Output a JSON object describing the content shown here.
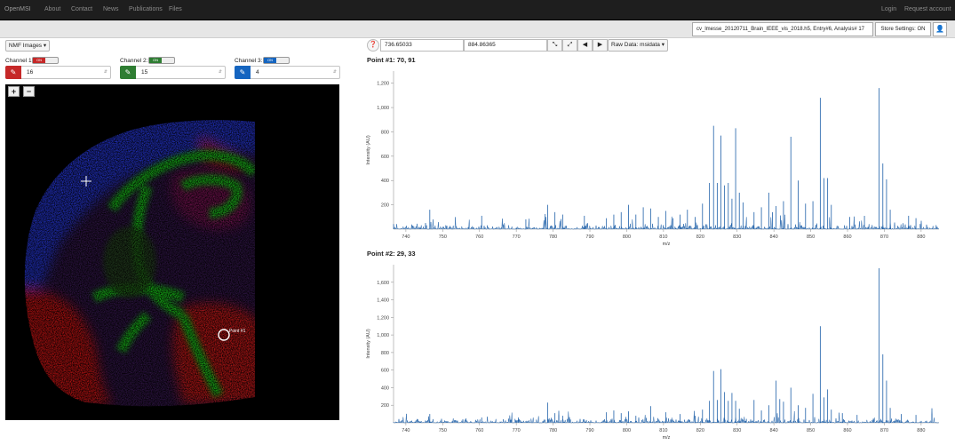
{
  "navbar": {
    "brand": "OpenMSI",
    "items": [
      "About",
      "Contact",
      "News",
      "Publications",
      "Files"
    ],
    "right": [
      "Login",
      "Request account"
    ]
  },
  "toolbar": {
    "file_name": "cv_lmesse_20120711_Brain_IEEE_vis_2018.h5, Entry#6, Analysis# 17",
    "store_settings": "Store Settings: ON",
    "user_icon": "user-icon"
  },
  "image_panel": {
    "dropdown_label": "NMF Images ▾",
    "channels": [
      {
        "label": "Channel 1:",
        "toggle": "ON",
        "value": "16",
        "color": "#c62828"
      },
      {
        "label": "Channel 2:",
        "toggle": "ON",
        "value": "15",
        "color": "#2e7d32"
      },
      {
        "label": "Channel 3:",
        "toggle": "ON",
        "value": "4",
        "color": "#1565c0"
      }
    ],
    "zoom_in": "+",
    "zoom_out": "−",
    "marker_label": "Point #1"
  },
  "spectrum_panel": {
    "mz_min": "736.65033",
    "mz_max": "884.86365",
    "raw_data_label": "Raw Data: msidata ▾",
    "point1_title": "Point #1: 70, 91",
    "point2_title": "Point #2: 29, 33"
  },
  "chart_data": [
    {
      "type": "line",
      "title": "Point #1: 70, 91",
      "xlabel": "m/z",
      "ylabel": "Intensity (AU)",
      "xlim": [
        736.65,
        884.86
      ],
      "ylim": [
        0,
        1300
      ],
      "xticks": [
        "740",
        "750",
        "760",
        "770",
        "780",
        "790",
        "800",
        "810",
        "820",
        "830",
        "840",
        "850",
        "860",
        "870",
        "880"
      ],
      "yticks": [
        "200",
        "400",
        "600",
        "800",
        "1,000",
        "1,200"
      ],
      "peaks": [
        {
          "x": 746.5,
          "y": 160
        },
        {
          "x": 760.6,
          "y": 110
        },
        {
          "x": 772.6,
          "y": 80
        },
        {
          "x": 778.5,
          "y": 200
        },
        {
          "x": 780.5,
          "y": 140
        },
        {
          "x": 782.6,
          "y": 120
        },
        {
          "x": 788.5,
          "y": 110
        },
        {
          "x": 794.5,
          "y": 90
        },
        {
          "x": 796.5,
          "y": 120
        },
        {
          "x": 798.5,
          "y": 140
        },
        {
          "x": 800.5,
          "y": 200
        },
        {
          "x": 802.5,
          "y": 120
        },
        {
          "x": 804.5,
          "y": 180
        },
        {
          "x": 806.5,
          "y": 170
        },
        {
          "x": 808.6,
          "y": 100
        },
        {
          "x": 810.6,
          "y": 150
        },
        {
          "x": 812.6,
          "y": 90
        },
        {
          "x": 814.5,
          "y": 120
        },
        {
          "x": 816.5,
          "y": 160
        },
        {
          "x": 818.6,
          "y": 100
        },
        {
          "x": 820.6,
          "y": 210
        },
        {
          "x": 822.5,
          "y": 380
        },
        {
          "x": 823.6,
          "y": 850
        },
        {
          "x": 824.6,
          "y": 380
        },
        {
          "x": 825.6,
          "y": 770
        },
        {
          "x": 826.6,
          "y": 360
        },
        {
          "x": 827.6,
          "y": 380
        },
        {
          "x": 828.6,
          "y": 250
        },
        {
          "x": 829.6,
          "y": 830
        },
        {
          "x": 830.6,
          "y": 300
        },
        {
          "x": 831.6,
          "y": 220
        },
        {
          "x": 834.6,
          "y": 140
        },
        {
          "x": 836.6,
          "y": 180
        },
        {
          "x": 838.6,
          "y": 300
        },
        {
          "x": 839.6,
          "y": 140
        },
        {
          "x": 840.6,
          "y": 190
        },
        {
          "x": 842.6,
          "y": 230
        },
        {
          "x": 844.6,
          "y": 760
        },
        {
          "x": 846.6,
          "y": 400
        },
        {
          "x": 848.6,
          "y": 210
        },
        {
          "x": 850.6,
          "y": 230
        },
        {
          "x": 852.6,
          "y": 1080
        },
        {
          "x": 853.6,
          "y": 420
        },
        {
          "x": 854.6,
          "y": 420
        },
        {
          "x": 855.6,
          "y": 200
        },
        {
          "x": 860.6,
          "y": 100
        },
        {
          "x": 864.6,
          "y": 110
        },
        {
          "x": 868.6,
          "y": 1160
        },
        {
          "x": 869.6,
          "y": 540
        },
        {
          "x": 870.6,
          "y": 410
        },
        {
          "x": 871.6,
          "y": 160
        },
        {
          "x": 876.6,
          "y": 110
        },
        {
          "x": 878.6,
          "y": 90
        }
      ]
    },
    {
      "type": "line",
      "title": "Point #2: 29, 33",
      "xlabel": "m/z",
      "ylabel": "Intensity (AU)",
      "xlim": [
        736.65,
        884.86
      ],
      "ylim": [
        0,
        1800
      ],
      "xticks": [
        "740",
        "750",
        "760",
        "770",
        "780",
        "790",
        "800",
        "810",
        "820",
        "830",
        "840",
        "850",
        "860",
        "870",
        "880"
      ],
      "yticks": [
        "200",
        "400",
        "600",
        "800",
        "1,000",
        "1,200",
        "1,400",
        "1,600"
      ],
      "peaks": [
        {
          "x": 746.5,
          "y": 100
        },
        {
          "x": 760.6,
          "y": 60
        },
        {
          "x": 770.6,
          "y": 60
        },
        {
          "x": 778.5,
          "y": 230
        },
        {
          "x": 780.5,
          "y": 110
        },
        {
          "x": 782.6,
          "y": 80
        },
        {
          "x": 794.5,
          "y": 120
        },
        {
          "x": 796.5,
          "y": 140
        },
        {
          "x": 798.5,
          "y": 110
        },
        {
          "x": 800.5,
          "y": 130
        },
        {
          "x": 802.5,
          "y": 80
        },
        {
          "x": 806.5,
          "y": 190
        },
        {
          "x": 810.6,
          "y": 120
        },
        {
          "x": 814.5,
          "y": 100
        },
        {
          "x": 818.6,
          "y": 80
        },
        {
          "x": 820.6,
          "y": 150
        },
        {
          "x": 822.5,
          "y": 250
        },
        {
          "x": 823.6,
          "y": 590
        },
        {
          "x": 824.6,
          "y": 260
        },
        {
          "x": 825.6,
          "y": 610
        },
        {
          "x": 826.6,
          "y": 350
        },
        {
          "x": 827.6,
          "y": 250
        },
        {
          "x": 828.6,
          "y": 340
        },
        {
          "x": 829.6,
          "y": 250
        },
        {
          "x": 830.6,
          "y": 160
        },
        {
          "x": 834.6,
          "y": 260
        },
        {
          "x": 836.6,
          "y": 140
        },
        {
          "x": 838.6,
          "y": 200
        },
        {
          "x": 840.6,
          "y": 480
        },
        {
          "x": 841.6,
          "y": 270
        },
        {
          "x": 842.6,
          "y": 240
        },
        {
          "x": 844.6,
          "y": 400
        },
        {
          "x": 846.6,
          "y": 200
        },
        {
          "x": 848.6,
          "y": 170
        },
        {
          "x": 850.6,
          "y": 330
        },
        {
          "x": 852.6,
          "y": 1100
        },
        {
          "x": 853.6,
          "y": 290
        },
        {
          "x": 854.6,
          "y": 380
        },
        {
          "x": 855.6,
          "y": 150
        },
        {
          "x": 858.6,
          "y": 110
        },
        {
          "x": 862.6,
          "y": 90
        },
        {
          "x": 868.6,
          "y": 1760
        },
        {
          "x": 869.6,
          "y": 780
        },
        {
          "x": 870.6,
          "y": 480
        },
        {
          "x": 871.6,
          "y": 170
        },
        {
          "x": 874.6,
          "y": 100
        },
        {
          "x": 878.6,
          "y": 90
        }
      ]
    }
  ]
}
